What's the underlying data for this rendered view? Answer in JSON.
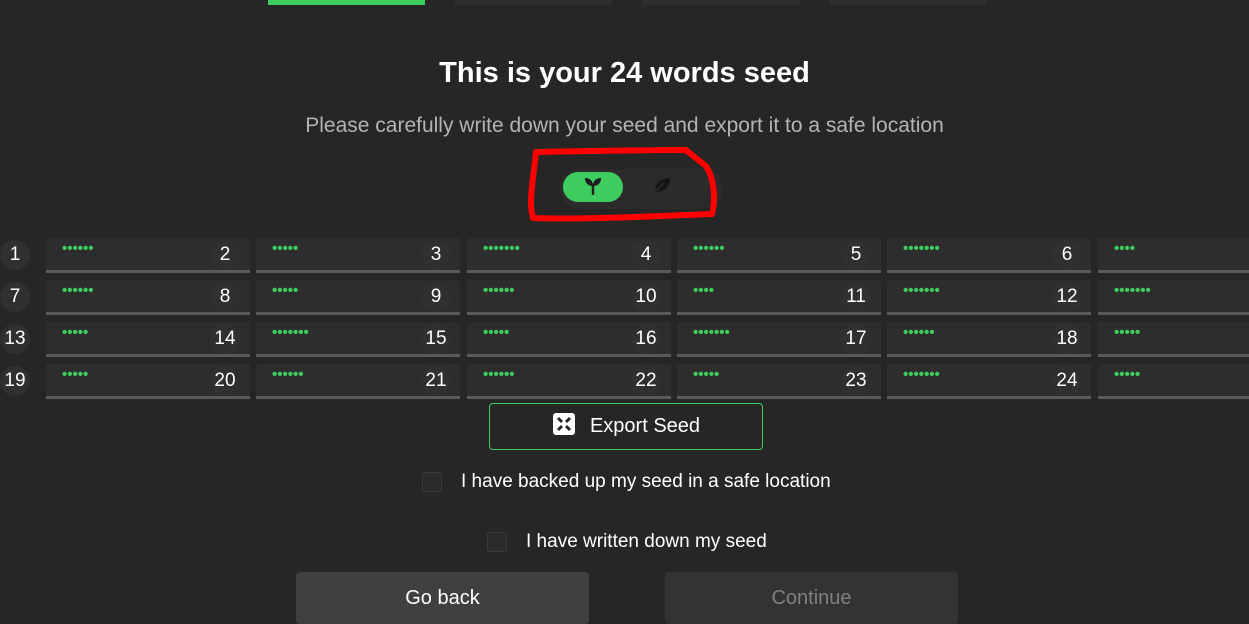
{
  "progress_steps": {
    "count": 4,
    "active_index": 0
  },
  "title": "This is your 24 words seed",
  "subtitle": "Please carefully write down your seed and export it to a safe location",
  "view_toggle": {
    "selected": "sprout",
    "options": [
      {
        "icon": "sprout-icon"
      },
      {
        "icon": "leaf-icon"
      }
    ]
  },
  "seed_words": [
    {
      "number": "1",
      "masked": "••••••"
    },
    {
      "number": "2",
      "masked": "•••••"
    },
    {
      "number": "3",
      "masked": "•••••••"
    },
    {
      "number": "4",
      "masked": "••••••"
    },
    {
      "number": "5",
      "masked": "•••••••"
    },
    {
      "number": "6",
      "masked": "••••"
    },
    {
      "number": "7",
      "masked": "••••••"
    },
    {
      "number": "8",
      "masked": "•••••"
    },
    {
      "number": "9",
      "masked": "••••••"
    },
    {
      "number": "10",
      "masked": "••••"
    },
    {
      "number": "11",
      "masked": "•••••••"
    },
    {
      "number": "12",
      "masked": "•••••••"
    },
    {
      "number": "13",
      "masked": "•••••"
    },
    {
      "number": "14",
      "masked": "•••••••"
    },
    {
      "number": "15",
      "masked": "•••••"
    },
    {
      "number": "16",
      "masked": "•••••••"
    },
    {
      "number": "17",
      "masked": "••••••"
    },
    {
      "number": "18",
      "masked": "•••••"
    },
    {
      "number": "19",
      "masked": "•••••"
    },
    {
      "number": "20",
      "masked": "••••••"
    },
    {
      "number": "21",
      "masked": "••••••"
    },
    {
      "number": "22",
      "masked": "•••••"
    },
    {
      "number": "23",
      "masked": "•••••••"
    },
    {
      "number": "24",
      "masked": "•••••"
    }
  ],
  "export_button": {
    "label": "Export Seed",
    "icon": "export-seed-icon"
  },
  "checkboxes": [
    {
      "label": "I have backed up my seed in a safe location",
      "checked": false
    },
    {
      "label": "I have written down my seed",
      "checked": false
    }
  ],
  "buttons": {
    "back": "Go back",
    "continue": "Continue"
  },
  "colors": {
    "accent": "#3fcc5f",
    "background": "#262626",
    "annotation": "#ff0000"
  }
}
